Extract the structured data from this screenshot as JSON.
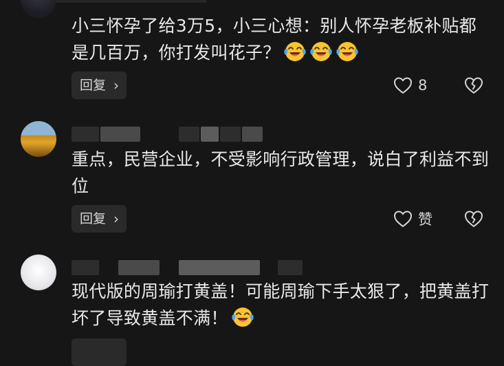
{
  "comments": [
    {
      "text": "小三怀孕了给3万5，小三心想：别人怀孕老板补贴都是几百万，你打发叫花子？",
      "emoji_count": 3,
      "reply_label": "回复",
      "like_label": "8"
    },
    {
      "text": "重点，民营企业，不受影响行政管理，说白了利益不到位",
      "emoji_count": 0,
      "reply_label": "回复",
      "like_label": "赞"
    },
    {
      "text": "现代版的周瑜打黄盖！可能周瑜下手太狠了，把黄盖打坏了导致黄盖不满！",
      "emoji_count": 1
    }
  ],
  "icons": {
    "reply_chevron": "›",
    "like": "heart-outline-icon",
    "dislike": "broken-heart-icon",
    "emoji": "laughing-tears-emoji"
  },
  "colors": {
    "background": "#161616",
    "text": "#e9e9e9",
    "button_bg": "#2a2a2a",
    "emoji_yellow": "#f7c531"
  }
}
